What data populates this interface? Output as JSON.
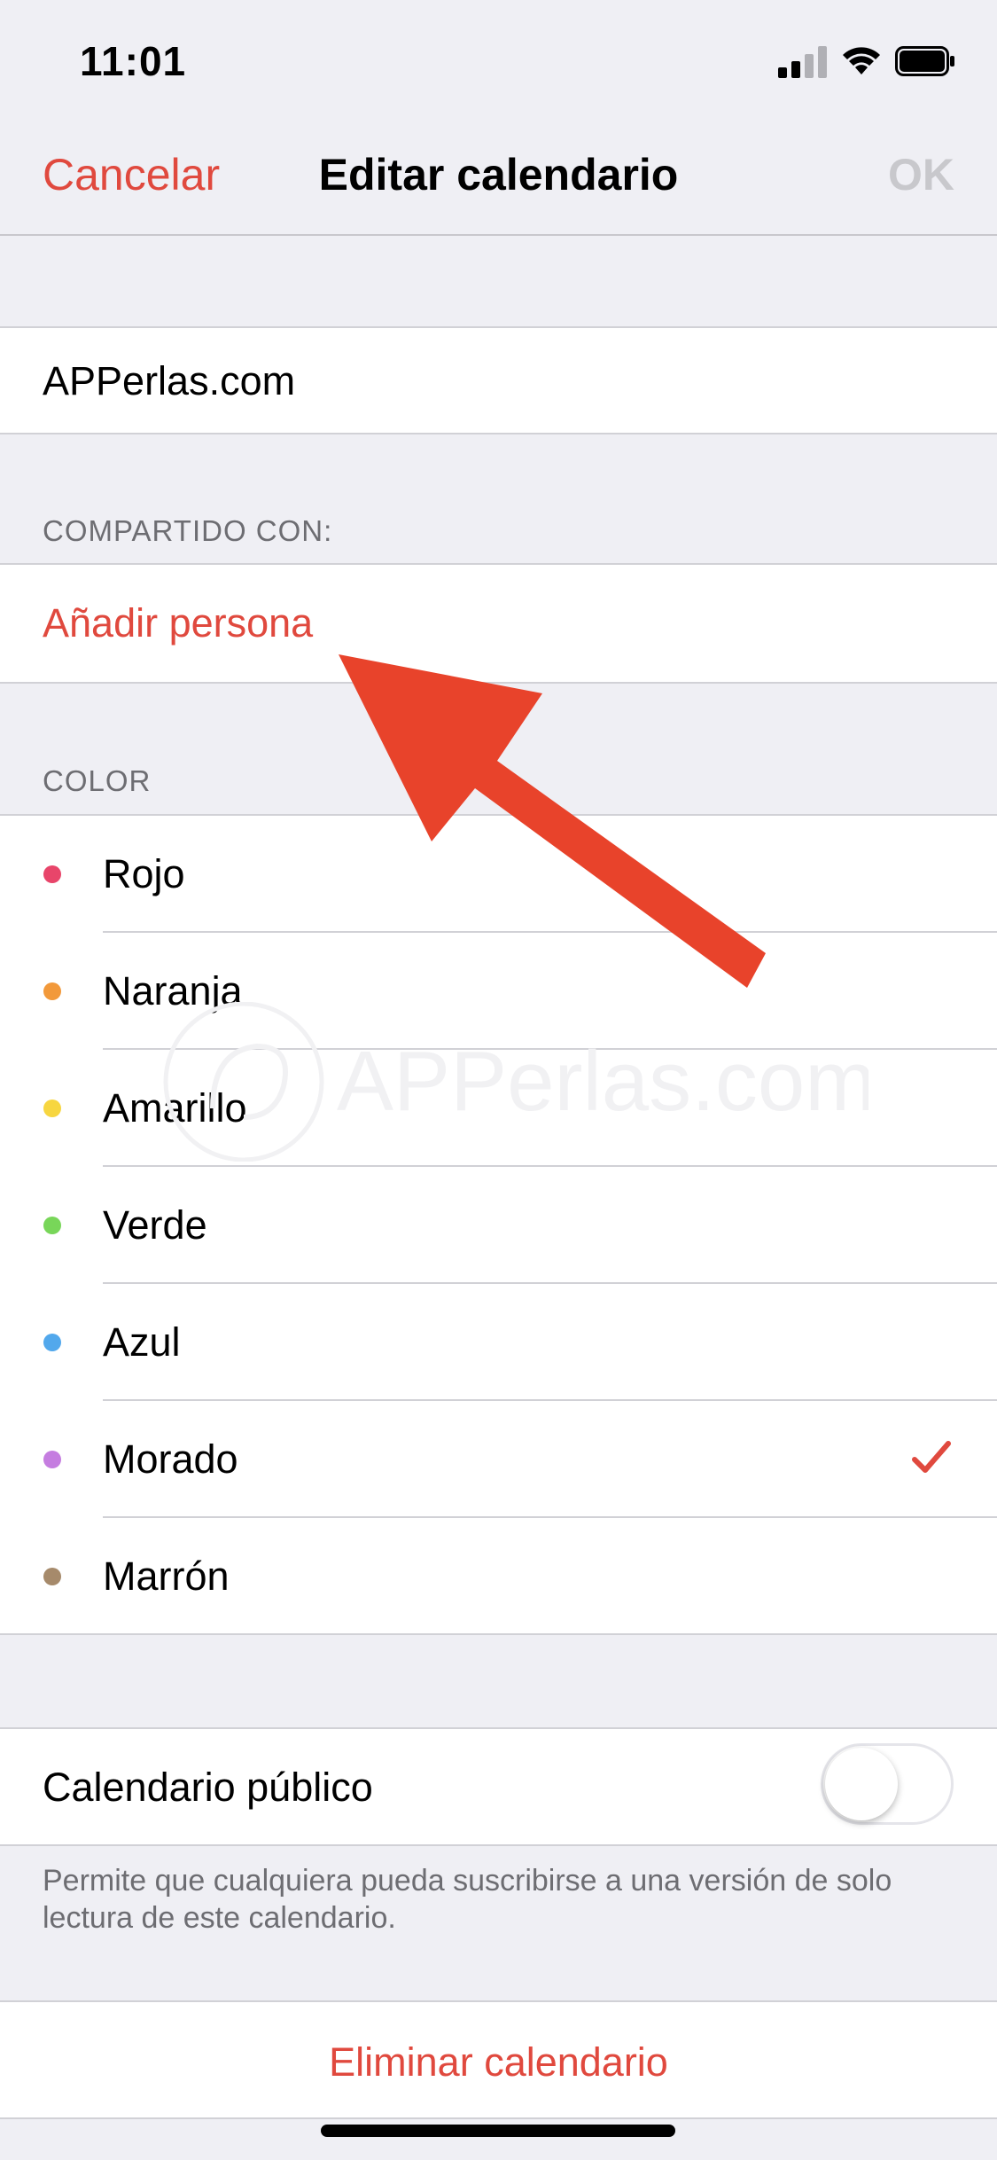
{
  "status_bar": {
    "time": "11:01"
  },
  "nav": {
    "cancel": "Cancelar",
    "title": "Editar calendario",
    "ok": "OK"
  },
  "calendar_name": "APPerlas.com",
  "shared": {
    "header": "COMPARTIDO CON:",
    "add_person": "Añadir persona"
  },
  "color": {
    "header": "COLOR",
    "items": [
      {
        "label": "Rojo",
        "color": "#e8456a"
      },
      {
        "label": "Naranja",
        "color": "#f2993a"
      },
      {
        "label": "Amarillo",
        "color": "#f7d640"
      },
      {
        "label": "Verde",
        "color": "#78d659"
      },
      {
        "label": "Azul",
        "color": "#52a8ec"
      },
      {
        "label": "Morado",
        "color": "#c57de0",
        "selected": true
      },
      {
        "label": "Marrón",
        "color": "#a68a6b"
      }
    ]
  },
  "public": {
    "label": "Calendario público",
    "enabled": false,
    "footnote": "Permite que cualquiera pueda suscribirse a una versión de solo lectura de este calendario."
  },
  "delete_label": "Eliminar calendario",
  "watermark_text": "APPerlas.com",
  "colors": {
    "accent": "#e0493e",
    "background": "#efeff4",
    "annotation_arrow": "#e8432b"
  }
}
